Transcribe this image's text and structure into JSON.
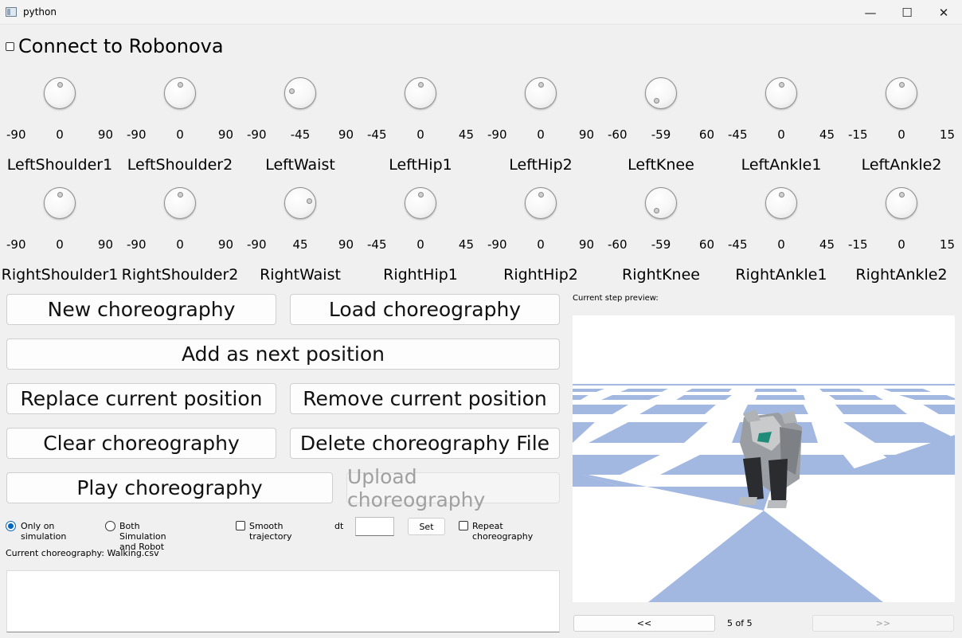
{
  "window": {
    "title": "python",
    "minimize": "—",
    "maximize": "☐",
    "close": "✕",
    "icon": "app-window-icon"
  },
  "connect": {
    "label": "Connect to Robonova",
    "checked": false
  },
  "dials_row1": [
    {
      "name": "LeftShoulder1",
      "min": "-90",
      "value": "0",
      "max": "90"
    },
    {
      "name": "LeftShoulder2",
      "min": "-90",
      "value": "0",
      "max": "90"
    },
    {
      "name": "LeftWaist",
      "min": "-90",
      "value": "-45",
      "max": "90"
    },
    {
      "name": "LeftHip1",
      "min": "-45",
      "value": "0",
      "max": "45"
    },
    {
      "name": "LeftHip2",
      "min": "-90",
      "value": "0",
      "max": "90"
    },
    {
      "name": "LeftKnee",
      "min": "-60",
      "value": "-59",
      "max": "60"
    },
    {
      "name": "LeftAnkle1",
      "min": "-45",
      "value": "0",
      "max": "45"
    },
    {
      "name": "LeftAnkle2",
      "min": "-15",
      "value": "0",
      "max": "15"
    }
  ],
  "dials_row2": [
    {
      "name": "RightShoulder1",
      "min": "-90",
      "value": "0",
      "max": "90"
    },
    {
      "name": "RightShoulder2",
      "min": "-90",
      "value": "0",
      "max": "90"
    },
    {
      "name": "RightWaist",
      "min": "-90",
      "value": "45",
      "max": "90"
    },
    {
      "name": "RightHip1",
      "min": "-45",
      "value": "0",
      "max": "45"
    },
    {
      "name": "RightHip2",
      "min": "-90",
      "value": "0",
      "max": "90"
    },
    {
      "name": "RightKnee",
      "min": "-60",
      "value": "-59",
      "max": "60"
    },
    {
      "name": "RightAnkle1",
      "min": "-45",
      "value": "0",
      "max": "45"
    },
    {
      "name": "RightAnkle2",
      "min": "-15",
      "value": "0",
      "max": "15"
    }
  ],
  "buttons": {
    "new": "New choreography",
    "load": "Load choreography",
    "add": "Add as next position",
    "replace": "Replace current position",
    "remove": "Remove current position",
    "clear": "Clear choreography",
    "delete": "Delete choreography File",
    "play": "Play choreography",
    "upload": "Upload choreography"
  },
  "options": {
    "only_sim": "Only on simulation",
    "both": "Both Simulation and Robot",
    "smooth": "Smooth trajectory",
    "dt_label": "dt",
    "dt_value": "",
    "set": "Set",
    "repeat": "Repeat choreography",
    "selected_mode": "Only on simulation"
  },
  "current_choreography": "Current choreography: Walking.csv",
  "preview": {
    "label": "Current step preview:",
    "prev": "<<",
    "next": ">>",
    "page": "5 of 5",
    "floor_color": "#a3b8e0",
    "sky_color": "#ffffff"
  }
}
